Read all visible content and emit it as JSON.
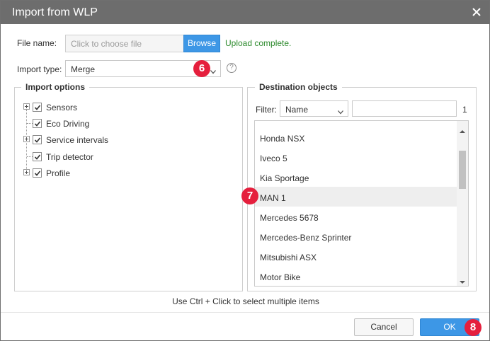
{
  "dialog": {
    "title": "Import from WLP",
    "close_icon": "close-icon"
  },
  "file": {
    "label": "File name:",
    "placeholder": "Click to choose file",
    "browse_label": "Browse",
    "status": "Upload complete.",
    "status_color": "#2e8b2e"
  },
  "import_type": {
    "label": "Import type:",
    "value": "Merge",
    "help_glyph": "?"
  },
  "badges": {
    "b6": "6",
    "b7": "7",
    "b8": "8",
    "color": "#e51f3d"
  },
  "import_options": {
    "legend": "Import options",
    "items": [
      {
        "label": "Sensors",
        "checked": true,
        "expandable": true
      },
      {
        "label": "Eco Driving",
        "checked": true,
        "expandable": false
      },
      {
        "label": "Service intervals",
        "checked": true,
        "expandable": true
      },
      {
        "label": "Trip detector",
        "checked": true,
        "expandable": false
      },
      {
        "label": "Profile",
        "checked": true,
        "expandable": true
      }
    ]
  },
  "destination": {
    "legend": "Destination objects",
    "filter_label": "Filter:",
    "filter_field": "Name",
    "filter_value": "",
    "count": "1",
    "items": [
      {
        "label": "Honda NSX",
        "selected": false
      },
      {
        "label": "Iveco 5",
        "selected": false
      },
      {
        "label": "Kia Sportage",
        "selected": false
      },
      {
        "label": "MAN 1",
        "selected": true
      },
      {
        "label": "Mercedes 5678",
        "selected": false
      },
      {
        "label": "Mercedes-Benz Sprinter",
        "selected": false
      },
      {
        "label": "Mitsubishi ASX",
        "selected": false
      },
      {
        "label": "Motor Bike",
        "selected": false
      }
    ]
  },
  "hint": "Use Ctrl + Click to select multiple items",
  "footer": {
    "cancel_label": "Cancel",
    "ok_label": "OK"
  },
  "colors": {
    "titlebar": "#6d6d6d",
    "accent": "#3d97e6"
  }
}
